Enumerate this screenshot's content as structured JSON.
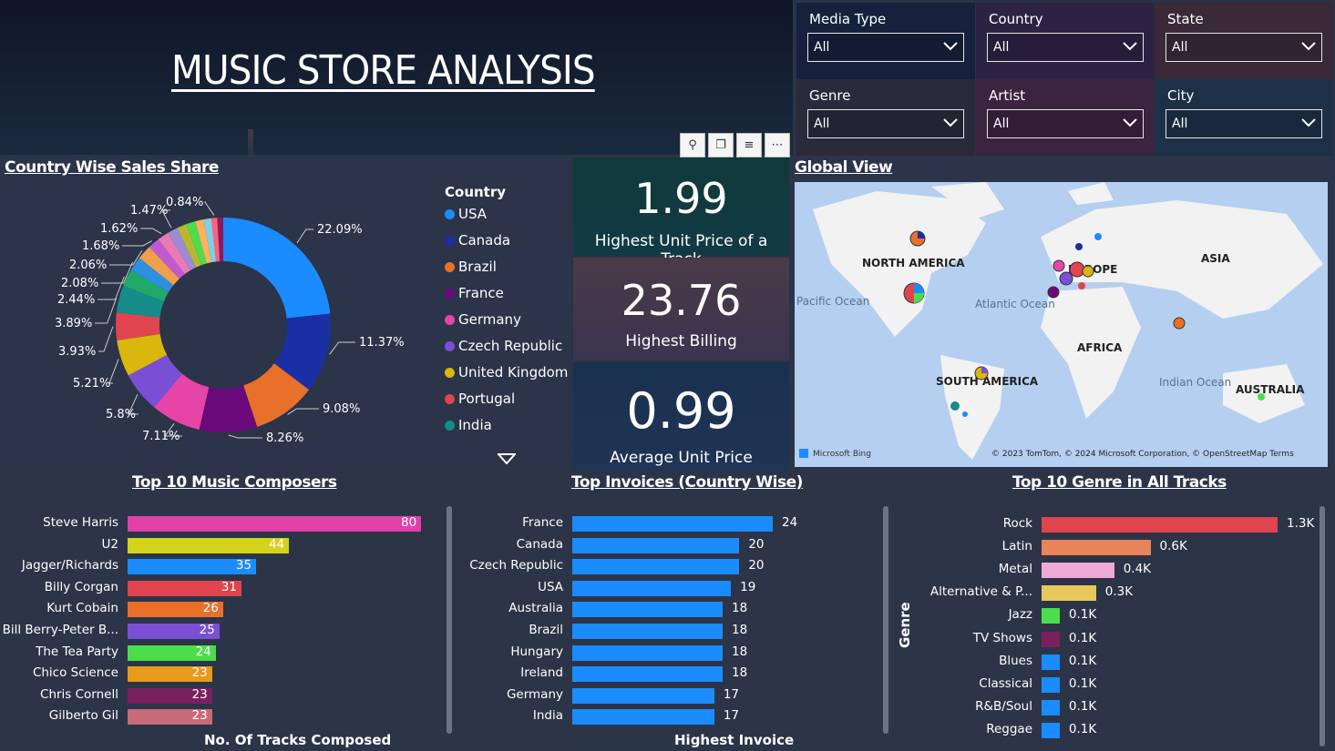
{
  "title": "MUSIC STORE ANALYSIS",
  "slicers": [
    {
      "label": "Media Type",
      "value": "All"
    },
    {
      "label": "Country",
      "value": "All"
    },
    {
      "label": "State",
      "value": "All"
    },
    {
      "label": "Genre",
      "value": "All"
    },
    {
      "label": "Artist",
      "value": "All"
    },
    {
      "label": "City",
      "value": "All"
    }
  ],
  "colors": {
    "usa": "#1a8cff",
    "canada": "#1a2fa3",
    "brazil": "#e8702a",
    "france": "#6a0a7a",
    "germany": "#e645a8",
    "czech": "#7a4fd6",
    "uk": "#d9b70d",
    "portugal": "#e0444f",
    "india": "#148c8c"
  },
  "sections": {
    "donut_title": "Country Wise Sales Share",
    "map_title": "Global View",
    "composers_title": "Top 10 Music Composers",
    "invoices_title": "Top Invoices (Country Wise)",
    "genre_title": "Top 10 Genre in All Tracks"
  },
  "kpis": [
    {
      "value": "1.99",
      "label": "Highest Unit Price of a Track"
    },
    {
      "value": "23.76",
      "label": "Highest Billing"
    },
    {
      "value": "0.99",
      "label": "Average Unit Price"
    }
  ],
  "map": {
    "labels": [
      "NORTH AMERICA",
      "EUROPE",
      "ASIA",
      "AFRICA",
      "SOUTH AMERICA",
      "AUSTRALIA"
    ],
    "oceans": [
      "Pacific Ocean",
      "Atlantic Ocean",
      "Indian Ocean"
    ],
    "attribution": "© 2023 TomTom, © 2024 Microsoft Corporation, © OpenStreetMap  Terms",
    "brand": "Microsoft Bing"
  },
  "chart_data": [
    {
      "type": "pie",
      "title": "Country Wise Sales Share",
      "legend_title": "Country",
      "legend": [
        "USA",
        "Canada",
        "Brazil",
        "France",
        "Germany",
        "Czech Republic",
        "United Kingdom",
        "Portugal",
        "India"
      ],
      "slices": [
        {
          "label": "22.09%",
          "value": 22.09
        },
        {
          "label": "11.37%",
          "value": 11.37
        },
        {
          "label": "9.08%",
          "value": 9.08
        },
        {
          "label": "8.26%",
          "value": 8.26
        },
        {
          "label": "7.11%",
          "value": 7.11
        },
        {
          "label": "5.8%",
          "value": 5.8
        },
        {
          "label": "5.21%",
          "value": 5.21
        },
        {
          "label": "3.93%",
          "value": 3.93
        },
        {
          "label": "3.89%",
          "value": 3.89
        },
        {
          "label": "2.44%",
          "value": 2.44
        },
        {
          "label": "2.08%",
          "value": 2.08
        },
        {
          "label": "2.06%",
          "value": 2.06
        },
        {
          "label": "1.68%",
          "value": 1.68
        },
        {
          "label": "1.62%",
          "value": 1.62
        },
        {
          "label": "1.47%",
          "value": 1.47
        },
        {
          "label": "",
          "value": 1.4
        },
        {
          "label": "",
          "value": 1.3
        },
        {
          "label": "",
          "value": 1.2
        },
        {
          "label": "",
          "value": 1.1
        },
        {
          "label": "0.84%",
          "value": 0.84
        },
        {
          "label": "",
          "value": 0.84
        }
      ]
    },
    {
      "type": "bar",
      "title": "Top 10 Music Composers",
      "xlabel": "No. Of Tracks Composed",
      "categories": [
        "Steve Harris",
        "U2",
        "Jagger/Richards",
        "Billy Corgan",
        "Kurt Cobain",
        "Bill Berry-Peter B...",
        "The Tea Party",
        "Chico Science",
        "Chris Cornell",
        "Gilberto Gil"
      ],
      "values": [
        80,
        44,
        35,
        31,
        26,
        25,
        24,
        23,
        23,
        23
      ],
      "colors": [
        "#e040a8",
        "#d4d21a",
        "#1a8cff",
        "#e0444f",
        "#e8702a",
        "#7a4fd6",
        "#4bde4b",
        "#e89a1a",
        "#7a2060",
        "#c86a78"
      ]
    },
    {
      "type": "bar",
      "title": "Top Invoices (Country Wise)",
      "xlabel": "Highest Invoice",
      "categories": [
        "France",
        "Canada",
        "Czech Republic",
        "USA",
        "Australia",
        "Brazil",
        "Hungary",
        "Ireland",
        "Germany",
        "India"
      ],
      "values": [
        24,
        20,
        20,
        19,
        18,
        18,
        18,
        18,
        17,
        17
      ]
    },
    {
      "type": "bar",
      "title": "Top 10 Genre in All Tracks",
      "ylabel": "Genre",
      "categories": [
        "Rock",
        "Latin",
        "Metal",
        "Alternative & P...",
        "Jazz",
        "TV Shows",
        "Blues",
        "Classical",
        "R&B/Soul",
        "Reggae"
      ],
      "values": [
        1.3,
        0.6,
        0.4,
        0.3,
        0.1,
        0.1,
        0.1,
        0.1,
        0.1,
        0.1
      ],
      "value_labels": [
        "1.3K",
        "0.6K",
        "0.4K",
        "0.3K",
        "0.1K",
        "0.1K",
        "0.1K",
        "0.1K",
        "0.1K",
        "0.1K"
      ],
      "colors": [
        "#e0444f",
        "#e8835a",
        "#f0a8d8",
        "#e8c85a",
        "#4bde4b",
        "#7a2060",
        "#1a8cff",
        "#1a8cff",
        "#1a8cff",
        "#1a8cff"
      ]
    }
  ]
}
